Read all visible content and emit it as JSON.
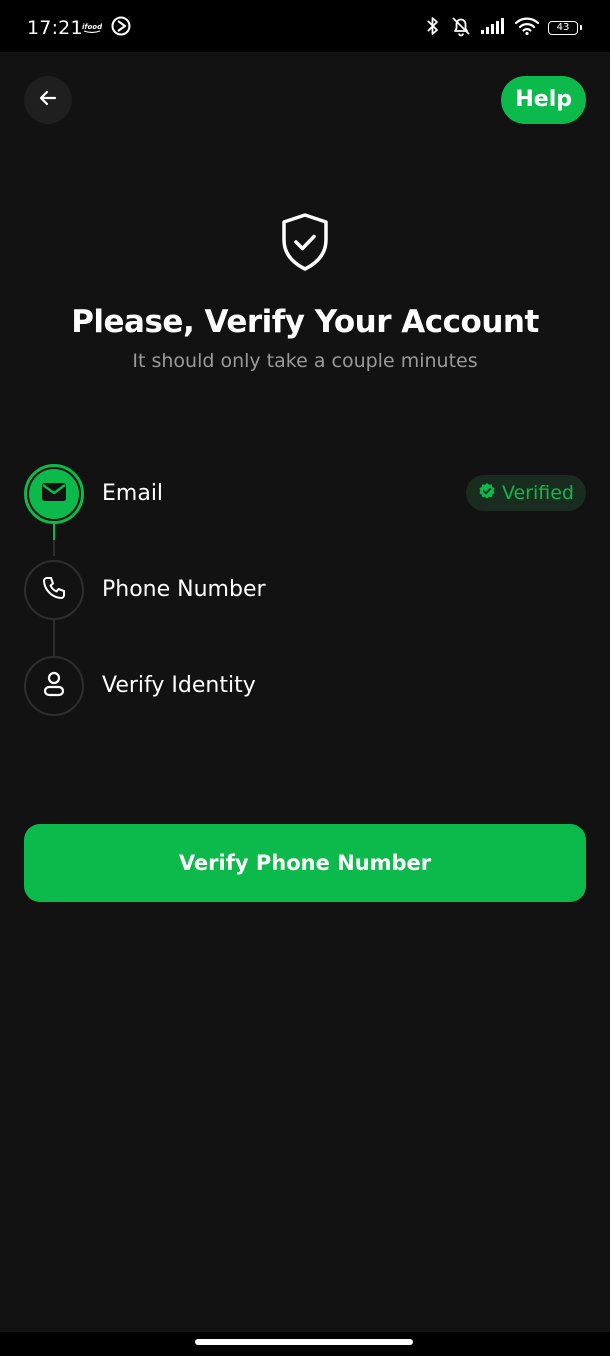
{
  "status_bar": {
    "time": "17:21",
    "battery_level": "43",
    "icons": [
      "ifood-icon",
      "progress-icon",
      "bluetooth-icon",
      "bell-off-icon",
      "signal-icon",
      "wifi-icon",
      "battery-icon"
    ]
  },
  "header": {
    "back_icon": "arrow-left-icon",
    "help_label": "Help"
  },
  "hero": {
    "icon": "shield-check-icon",
    "title": "Please, Verify Your Account",
    "subtitle": "It should only take a couple minutes"
  },
  "steps": [
    {
      "label": "Email",
      "icon": "mail-icon",
      "status": "Verified",
      "completed": true
    },
    {
      "label": "Phone Number",
      "icon": "phone-icon",
      "completed": false
    },
    {
      "label": "Verify Identity",
      "icon": "user-icon",
      "completed": false
    }
  ],
  "primary_action": {
    "label": "Verify Phone Number"
  },
  "colors": {
    "accent": "#0bba4a",
    "background": "#121212",
    "surface": "#1f1f1f",
    "muted_text": "#9a9a9a",
    "badge_bg": "#1a2c20"
  }
}
